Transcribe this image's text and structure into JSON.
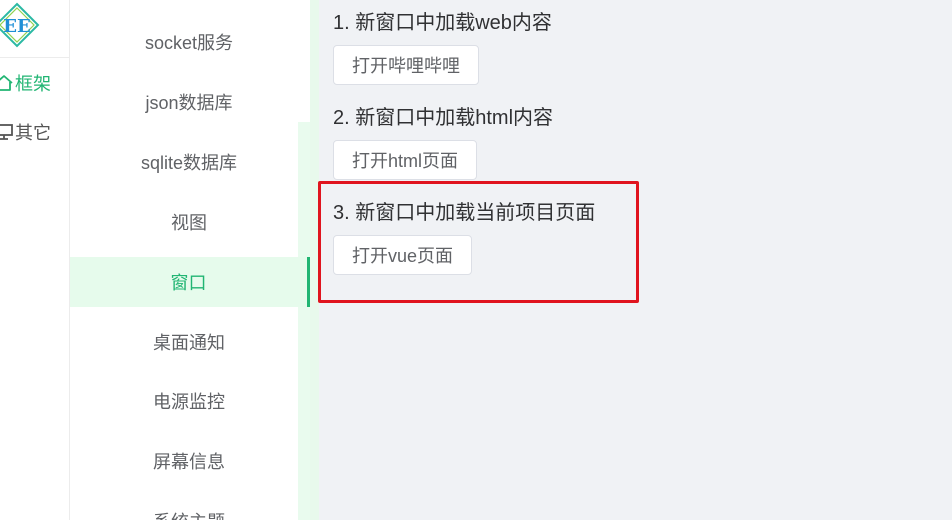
{
  "rail": {
    "logo_text": "EE",
    "items": [
      {
        "label": "框架",
        "icon": "home-icon"
      },
      {
        "label": "其它",
        "icon": "monitor-icon"
      }
    ]
  },
  "submenu": {
    "items": [
      "socket服务",
      "json数据库",
      "sqlite数据库",
      "视图",
      "窗口",
      "桌面通知",
      "电源监控",
      "屏幕信息",
      "系统主题"
    ],
    "active": "窗口"
  },
  "main": {
    "sections": [
      {
        "title": "1. 新窗口中加载web内容",
        "button": "打开哔哩哔哩"
      },
      {
        "title": "2. 新窗口中加载html内容",
        "button": "打开html页面"
      },
      {
        "title": "3. 新窗口中加载当前项目页面",
        "button": "打开vue页面"
      }
    ]
  },
  "colors": {
    "accent": "#21b573",
    "highlight": "#e0141e",
    "main_bg": "#f0f2f5"
  }
}
